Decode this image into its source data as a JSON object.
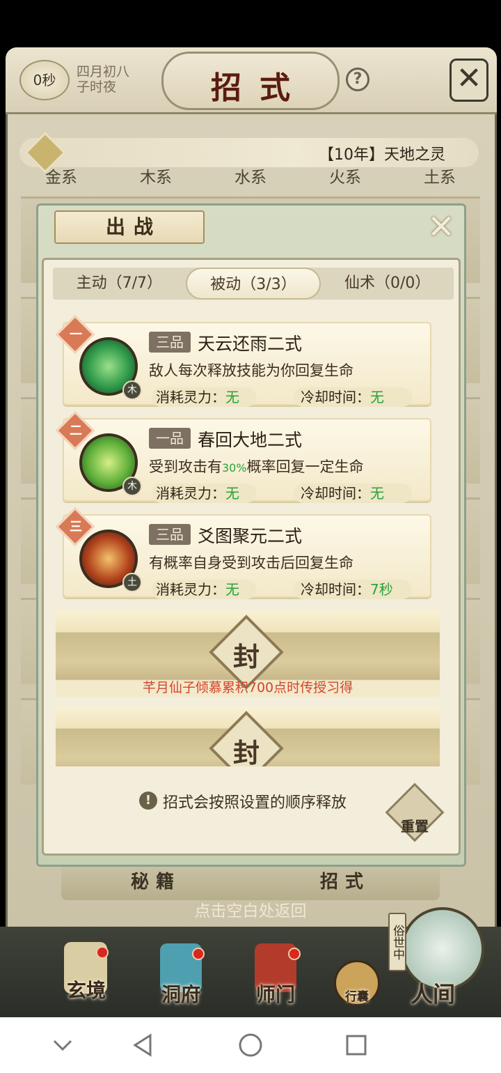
{
  "header": {
    "timer": "0秒",
    "date_line1": "四月初八",
    "date_line2": "子时夜",
    "title": "招式",
    "help_symbol": "?",
    "close_symbol": "✕"
  },
  "banner": {
    "title_tag": "【10年】天地之灵"
  },
  "element_tabs": [
    {
      "label": "金系"
    },
    {
      "label": "木系"
    },
    {
      "label": "水系"
    },
    {
      "label": "火系"
    },
    {
      "label": "土系"
    }
  ],
  "panel": {
    "tag": "出战",
    "close_symbol": "✕",
    "tabs": [
      {
        "label": "主动（7/7）"
      },
      {
        "label": "被动（3/3）"
      },
      {
        "label": "仙术（0/0）"
      }
    ],
    "skills": [
      {
        "order": "一",
        "grade": "三品",
        "name": "天云还雨二式",
        "desc_pre": "敌人每次释放技能为你回复生命",
        "desc_highlight": "",
        "desc_post": "",
        "element": "木",
        "cost_label": "消耗灵力：",
        "cost_value": "无",
        "cd_label": "冷却时间：",
        "cd_value": "无",
        "icon_color": "#2f9a4a"
      },
      {
        "order": "二",
        "grade": "一品",
        "name": "春回大地二式",
        "desc_pre": "受到攻击有",
        "desc_highlight": "30%",
        "desc_post": "概率回复一定生命",
        "element": "木",
        "cost_label": "消耗灵力：",
        "cost_value": "无",
        "cd_label": "冷却时间：",
        "cd_value": "无",
        "icon_color": "#5fb03a"
      },
      {
        "order": "三",
        "grade": "三品",
        "name": "爻图聚元二式",
        "desc_pre": "有概率自身受到攻击后回复生命",
        "desc_highlight": "",
        "desc_post": "",
        "element": "土",
        "cost_label": "消耗灵力：",
        "cost_value": "无",
        "cd_label": "冷却时间：",
        "cd_value": "7秒",
        "icon_color": "#b3451e"
      }
    ],
    "locked_slots": [
      {
        "seal": "封",
        "requirement": "芊月仙子倾慕累积700点时传授习得"
      },
      {
        "seal": "封",
        "requirement": ""
      }
    ],
    "tip_icon": "!",
    "tip": "招式会按照设置的顺序释放",
    "reset_label": "重置"
  },
  "bottom_tabs": [
    {
      "label": "秘籍"
    },
    {
      "label": "招式"
    }
  ],
  "back_hint": "点击空白处返回",
  "bottom_nav": [
    {
      "label": "玄境"
    },
    {
      "label": "洞府"
    },
    {
      "label": "师门"
    },
    {
      "label": "行囊"
    },
    {
      "label": "人间"
    }
  ],
  "side_badge": "俗世中"
}
